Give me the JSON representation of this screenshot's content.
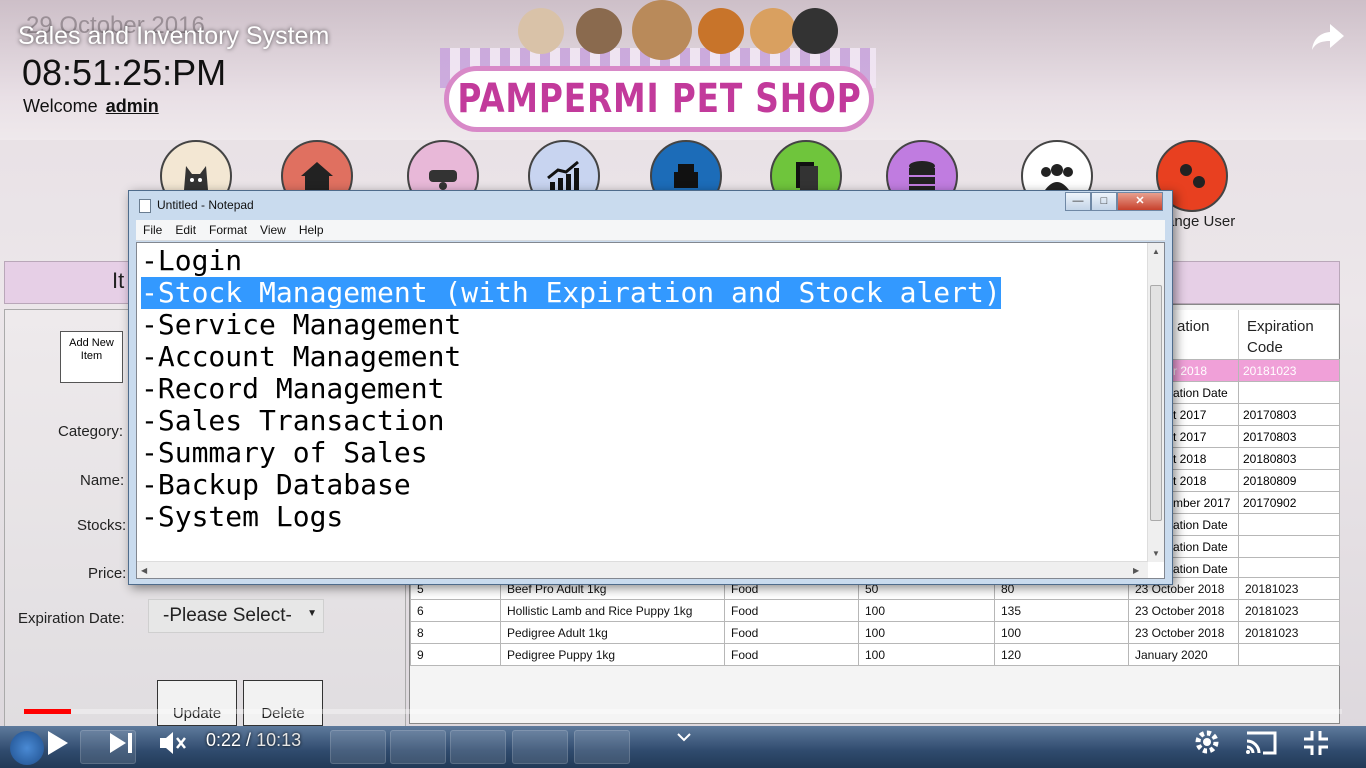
{
  "video": {
    "title": "Sales and Inventory System",
    "current_time": "0:22",
    "total_time": "10:13",
    "progress_fraction": 0.036
  },
  "app": {
    "date": "29 October 2016",
    "clock": "08:51:25:PM",
    "welcome_label": "Welcome",
    "user": "admin",
    "shop_name": "PAMPERMI PET SHOP",
    "change_user_label": "ange User",
    "panel_title": "It",
    "add_button": "Add New Item",
    "fields": {
      "category": "Category:",
      "name": "Name:",
      "stocks": "Stocks:",
      "price": "Price:",
      "expiration": "Expiration Date:"
    },
    "expiration_select": "-Please Select-",
    "update_button": "Update",
    "delete_button": "Delete",
    "table_headers": {
      "expiration_partial": "ation",
      "expiration_code": "Expiration Code"
    },
    "right_rows": [
      {
        "date": "r 2018",
        "code": "20181023"
      },
      {
        "date": "ation Date",
        "code": ""
      },
      {
        "date": "t 2017",
        "code": "20170803"
      },
      {
        "date": "t 2017",
        "code": "20170803"
      },
      {
        "date": "t 2018",
        "code": "20180803"
      },
      {
        "date": "t 2018",
        "code": "20180809"
      },
      {
        "date": "mber 2017",
        "code": "20170902"
      },
      {
        "date": "ation Date",
        "code": ""
      },
      {
        "date": "ation Date",
        "code": ""
      },
      {
        "date": "ation Date",
        "code": ""
      }
    ],
    "bottom_rows": [
      {
        "id": "5",
        "name": "Beef Pro Adult 1kg",
        "category": "Food",
        "stocks": "50",
        "price": "80",
        "expiration": "23 October 2018",
        "code": "20181023"
      },
      {
        "id": "6",
        "name": "Hollistic Lamb and Rice Puppy 1kg",
        "category": "Food",
        "stocks": "100",
        "price": "135",
        "expiration": "23 October 2018",
        "code": "20181023"
      },
      {
        "id": "8",
        "name": "Pedigree Adult 1kg",
        "category": "Food",
        "stocks": "100",
        "price": "100",
        "expiration": "23 October 2018",
        "code": "20181023"
      },
      {
        "id": "9",
        "name": "Pedigree Puppy 1kg",
        "category": "Food",
        "stocks": "100",
        "price": "120",
        "expiration": "January 2020",
        "code": ""
      }
    ]
  },
  "notepad": {
    "title": "Untitled - Notepad",
    "menu": [
      "File",
      "Edit",
      "Format",
      "View",
      "Help"
    ],
    "lines": [
      "-Login",
      "-Stock Management (with Expiration and Stock alert)",
      "-Service Management",
      "-Account Management",
      "-Record Management",
      "-Sales Transaction",
      "-Summary of Sales",
      "-Backup Database",
      "-System Logs"
    ],
    "selected_line": 1
  },
  "colors": {
    "selection": "#3399ff",
    "progress": "#ff0000",
    "logo_pink": "#c23a9b",
    "pink_row": "#f0a0d8"
  }
}
